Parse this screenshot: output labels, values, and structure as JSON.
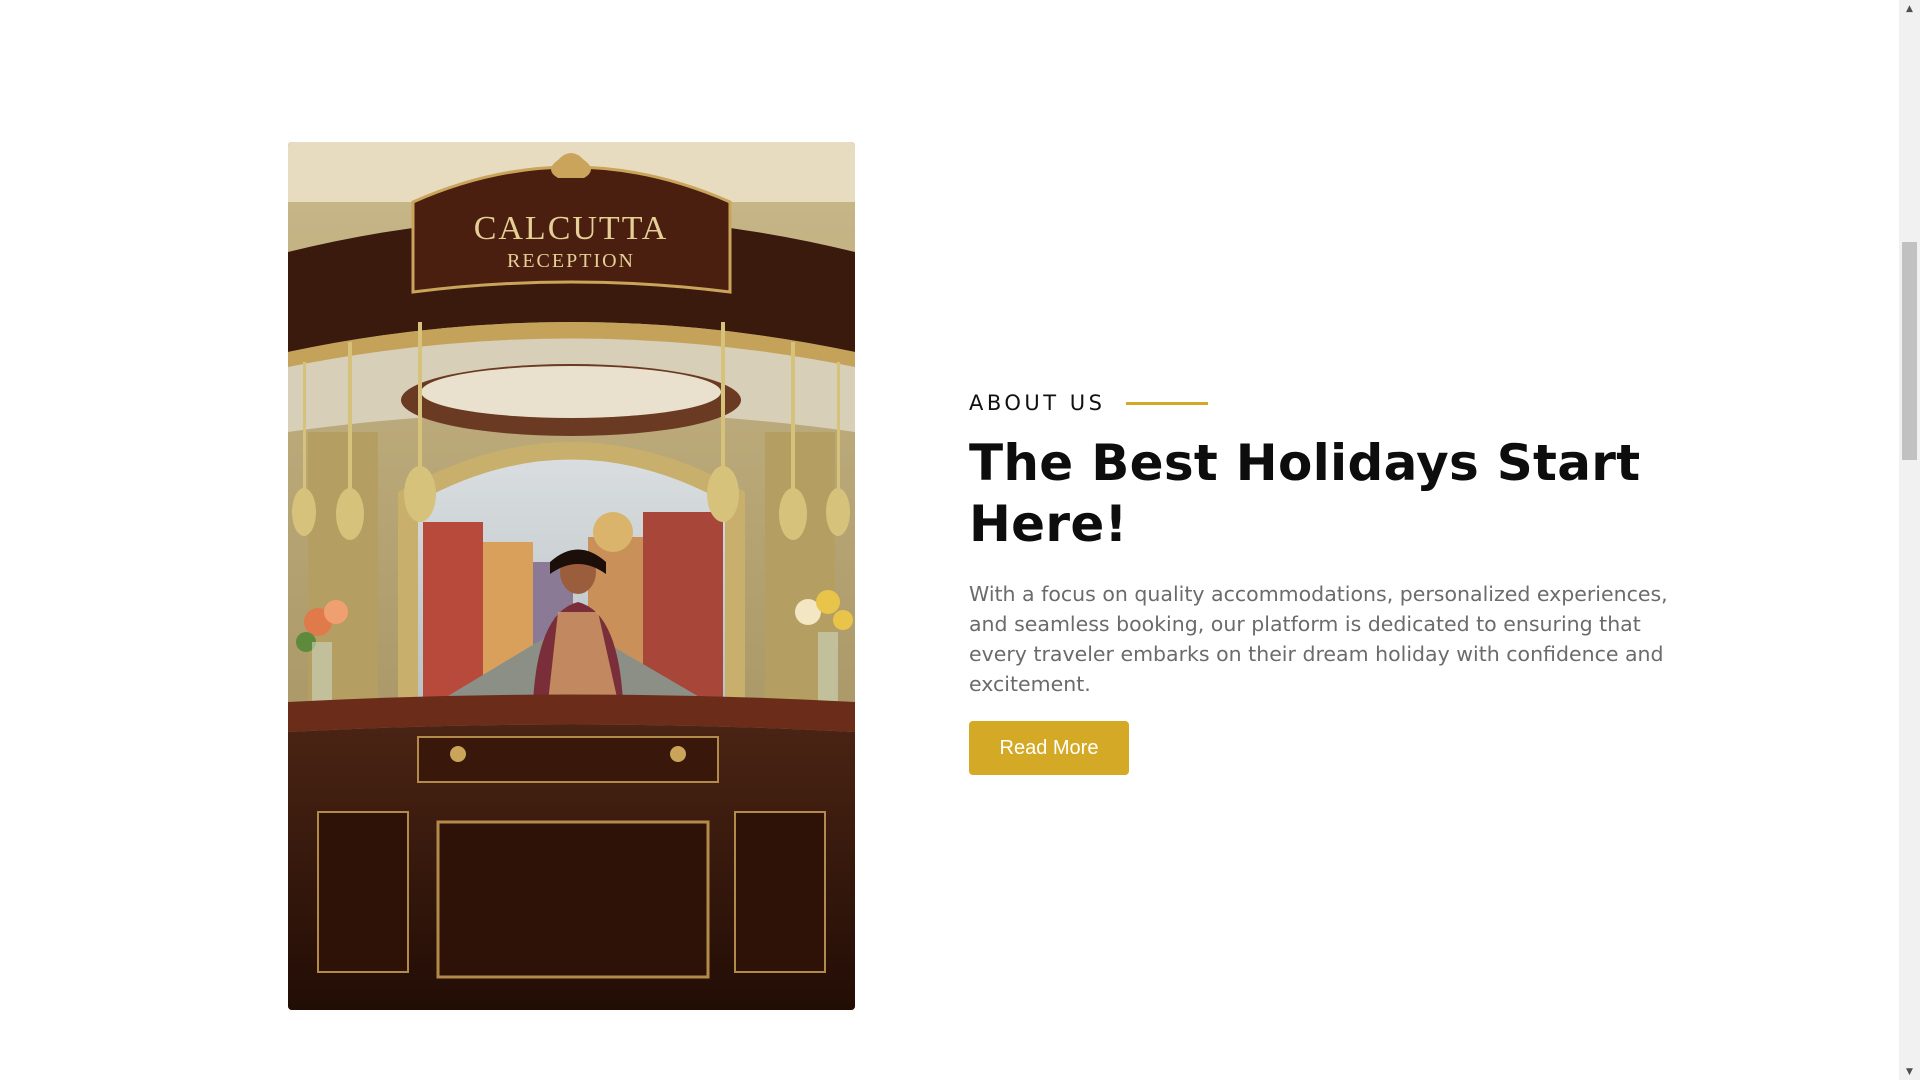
{
  "about": {
    "eyebrow": "ABOUT US",
    "headline": "The Best Holidays Start Here!",
    "description": "With a focus on quality accommodations, personalized experiences, and seamless booking, our platform is dedicated to ensuring that every traveler embarks on their dream holiday with confidence and excitement.",
    "button_label": "Read More"
  },
  "photo": {
    "sign_line1": "CALCUTTA",
    "sign_line2": "RECEPTION"
  },
  "colors": {
    "accent": "#d3a925",
    "heading": "#0d0d0d",
    "body_text": "#6b6b6b",
    "background": "#ffffff"
  },
  "scrollbar": {
    "up_icon": "triangle-up-icon",
    "down_icon": "triangle-down-icon"
  }
}
